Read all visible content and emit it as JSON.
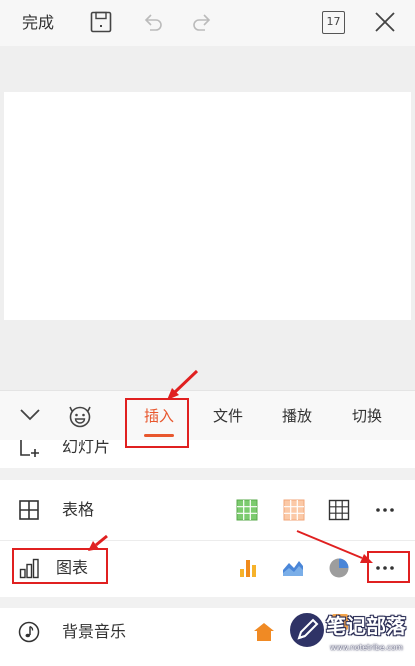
{
  "topbar": {
    "done_label": "完成",
    "slide_count": "17",
    "icons": [
      "save-icon",
      "undo-icon",
      "redo-icon",
      "slide-count-icon",
      "close-icon"
    ]
  },
  "toolbar": {
    "collapse_icon": "chevron-down-icon",
    "emoji_icon": "emoji-icon",
    "tabs": [
      {
        "label": "插入",
        "active": true
      },
      {
        "label": "文件",
        "active": false
      },
      {
        "label": "播放",
        "active": false
      },
      {
        "label": "切换",
        "active": false
      }
    ]
  },
  "insert_menu": {
    "rows": [
      {
        "label": "幻灯片",
        "icon": "add-slide-icon"
      },
      {
        "label": "表格",
        "icon": "table-icon",
        "options": [
          "green-table-style-icon",
          "orange-table-style-icon",
          "plain-table-style-icon",
          "more-icon"
        ]
      },
      {
        "label": "图表",
        "icon": "bar-chart-icon",
        "options": [
          "column-chart-icon",
          "area-chart-icon",
          "pie-chart-icon",
          "more-icon"
        ]
      },
      {
        "label": "背景音乐",
        "icon": "music-icon"
      }
    ]
  },
  "watermark": {
    "name": "笔记部落",
    "url": "www.notetribe.com"
  },
  "colors": {
    "accent": "#e8572e",
    "annotation": "#e02020",
    "table_green": "#7ccb6f",
    "table_orange": "#fbc9a7",
    "chart_orange": "#f08b1c",
    "chart_blue": "#4a86d8"
  }
}
